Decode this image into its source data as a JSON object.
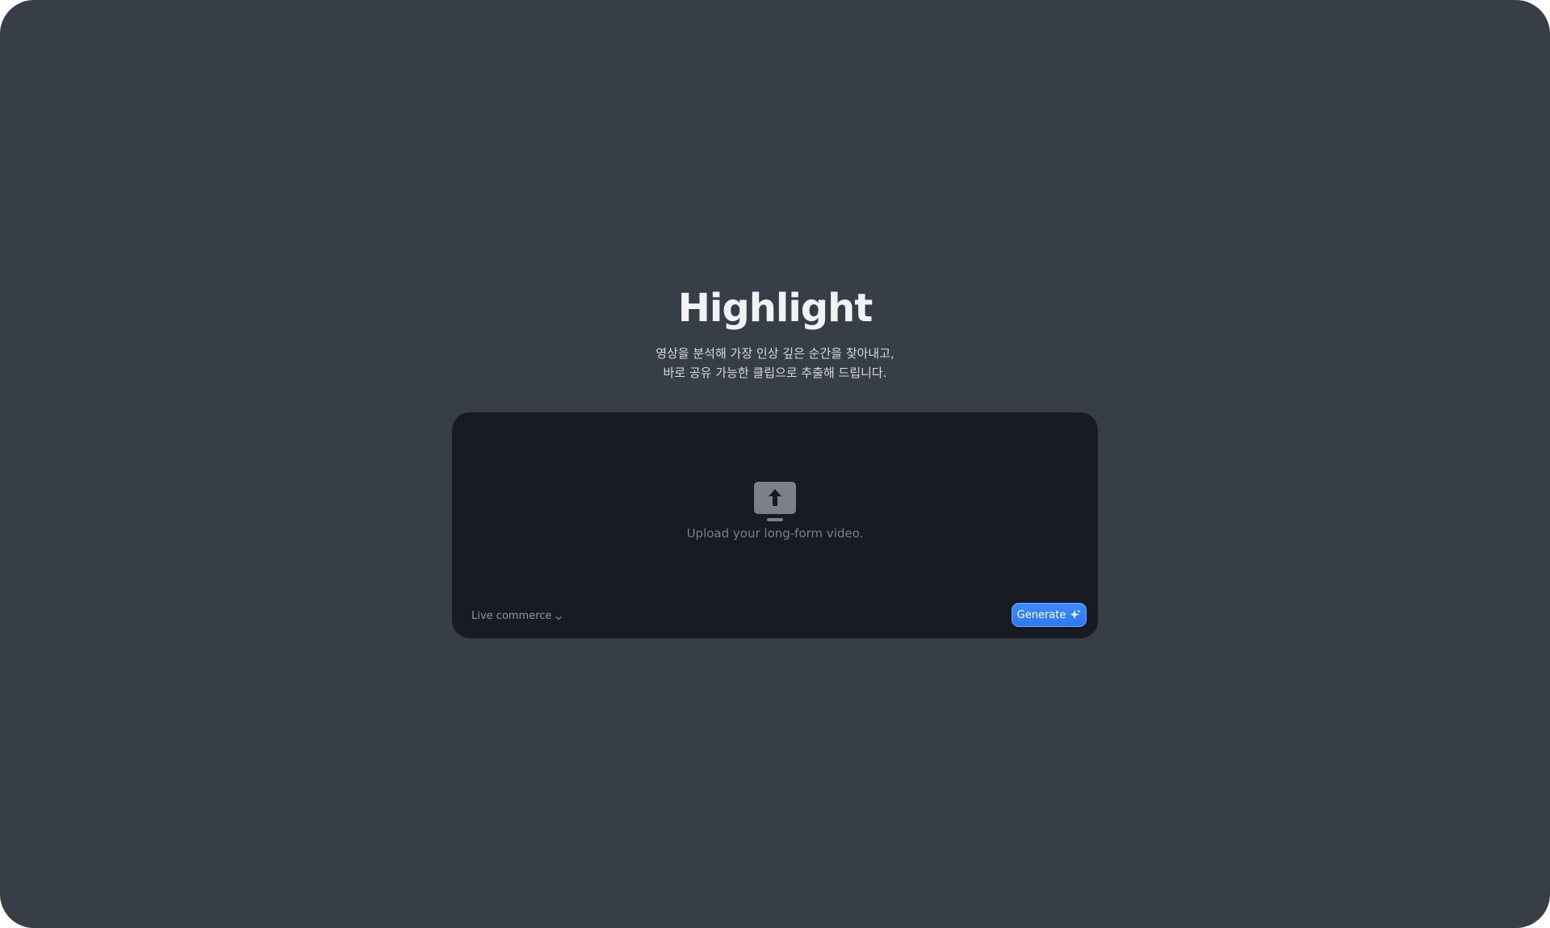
{
  "hero": {
    "title": "Highlight",
    "subtitle_line1": "영상을 분석해 가장 인상 깊은 순간을 찾아내고,",
    "subtitle_line2": "바로 공유 가능한 클립으로 추출해 드립니다."
  },
  "upload": {
    "icon": "upload-icon",
    "prompt": "Upload your long-form video."
  },
  "mode_select": {
    "selected": "Live commerce",
    "icon": "chevron-down-icon"
  },
  "generate_button": {
    "label": "Generate",
    "icon": "sparkle-icon"
  },
  "colors": {
    "background": "#383e48",
    "card": "#181b22",
    "accent": "#3c8cff"
  }
}
